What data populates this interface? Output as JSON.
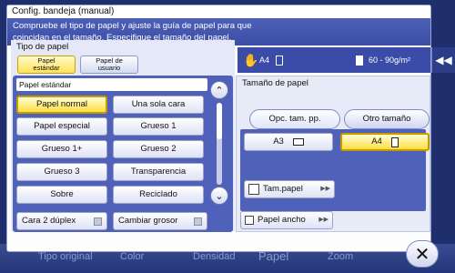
{
  "dialog": {
    "title": "Config. bandeja (manual)",
    "message_line1": "Compruebe el tipo de papel y ajuste la guía de papel para que",
    "message_line2": "coincidan en el tamaño. Especifique el tamaño del papel."
  },
  "paper_type": {
    "label": "Tipo de papel",
    "tabs": [
      "Papel\nestándar",
      "Papel de\nusuario"
    ],
    "sub_header": "Papel estándar",
    "items": [
      "Papel normal",
      "Una sola cara",
      "Papel especial",
      "Grueso 1",
      "Grueso 1+",
      "Grueso 2",
      "Grueso 3",
      "Transparencia",
      "Sobre",
      "Reciclado"
    ],
    "duplex_label": "Cara 2 dúplex",
    "thickness_label": "Cambiar grosor"
  },
  "status": {
    "size": "A4",
    "weight": "60 - 90g/m²"
  },
  "paper_size": {
    "label": "Tamaño de papel",
    "tab_std": "Opc. tam. pp.",
    "tab_other": "Otro tamaño",
    "btn_a3": "A3",
    "btn_a4": "A4",
    "tam_papel": "Tam.papel",
    "papel_ancho": "Papel ancho"
  },
  "background_tabs": [
    "Tipo original",
    "Color",
    "Densidad",
    "Papel",
    "Zoom"
  ],
  "colors": {
    "accent": "#3b4ea6",
    "selected": "#ffe040"
  }
}
